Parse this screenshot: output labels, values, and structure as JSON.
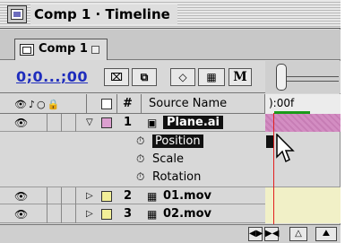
{
  "window": {
    "title": "Comp 1 · Timeline"
  },
  "tab": {
    "label": "Comp 1"
  },
  "toolbar": {
    "timecode": "0;0...;00",
    "buttons": [
      "⌧",
      "⧉",
      "◇",
      "▦",
      "M"
    ]
  },
  "columns": {
    "switch_icons": "👁♪○🔒",
    "label_col": "",
    "number_col": "#",
    "source_name": "Source Name",
    "time_start": "):00f"
  },
  "layers": [
    {
      "number": "1",
      "name": "Plane.ai",
      "color": "#dc9fd0",
      "expanded": true,
      "selected": true,
      "icon": "ai-file-icon"
    },
    {
      "number": "2",
      "name": "01.mov",
      "color": "#f2ef98",
      "expanded": false,
      "selected": false,
      "icon": "movie-icon"
    },
    {
      "number": "3",
      "name": "02.mov",
      "color": "#f2ef98",
      "expanded": false,
      "selected": false,
      "icon": "movie-icon"
    }
  ],
  "properties": [
    {
      "name": "Position",
      "selected": true
    },
    {
      "name": "Scale",
      "selected": false
    },
    {
      "name": "Rotation",
      "selected": false
    }
  ],
  "colors": {
    "timecode": "#1f2dbd",
    "time_indicator": "#e21f1f",
    "work_area": "#1a9a1a"
  }
}
